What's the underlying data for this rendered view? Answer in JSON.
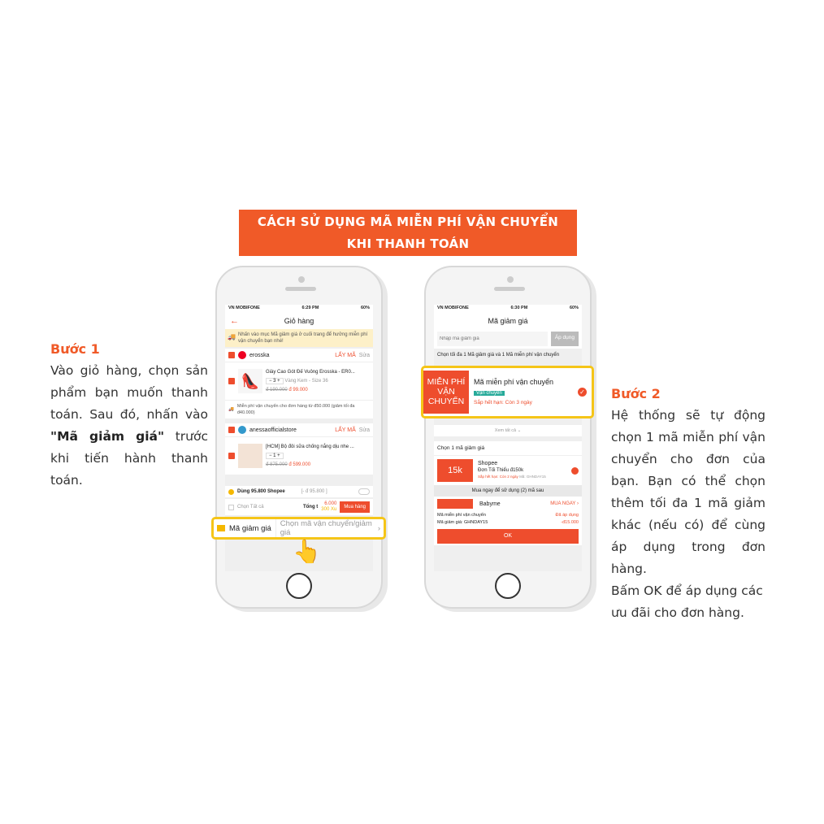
{
  "banner": {
    "line1": "CÁCH SỬ DỤNG MÃ MIỄN PHÍ VẬN CHUYỂN",
    "line2": "KHI THANH TOÁN"
  },
  "step1": {
    "title": "Bước 1",
    "text_a": "Vào giỏ hàng, chọn sản phẩm bạn muốn thanh toán. Sau đó, nhấn vào ",
    "bold": "\"Mã giảm giá\"",
    "text_b": " trước khi tiến hành thanh toán."
  },
  "step2": {
    "title": "Bước 2",
    "text": "Hệ thống sẽ tự động chọn 1 mã miễn phí vận chuyển cho đơn của bạn. Bạn có thể chọn thêm tối đa 1 mã giảm khác (nếu có) để cùng áp dụng trong đơn hàng.",
    "text2": "Bấm OK để áp dụng các ưu đãi cho đơn hàng."
  },
  "phone1": {
    "status": {
      "carrier": "VN MOBIFONE",
      "time": "6:29 PM",
      "battery": "60%"
    },
    "title": "Giỏ hàng",
    "notice": "Nhấn vào mục Mã giảm giá ở cuối trang để hưởng miễn phí vận chuyển bạn nhé!",
    "shops": [
      {
        "name": "erosska",
        "get_code": "LẤY MÃ",
        "edit": "Sửa",
        "product": "Giày Cao Gót Đế Vuông Erosska - ER0...",
        "qty": "3",
        "variant": "Vàng Kem - Size 36",
        "old_price": "đ 190.000",
        "price": "đ 99.000",
        "shipping": "Miễn phí vận chuyển cho đơn hàng từ đ50.000 (giảm tối đa đ40.000)"
      },
      {
        "name": "anessaofficialstore",
        "get_code": "LẤY MÃ",
        "edit": "Sửa",
        "product": "[HCM] Bộ đôi sữa chống nắng dịu nhe ...",
        "qty": "1",
        "old_price": "đ 875.000",
        "price": "đ 599.000"
      }
    ],
    "voucher_label": "Mã giảm giá",
    "voucher_placeholder": "Chọn mã vận chuyển/giảm giá",
    "coins": "Dùng 95.800 Shopee",
    "coins_value": "[- đ 95.800 ]",
    "select_all": "Chọn Tất cả",
    "total_label": "Tổng t",
    "total": "6.000",
    "xu": "300 Xu",
    "buy": "Mua hàng"
  },
  "phone2": {
    "status": {
      "carrier": "VN MOBIFONE",
      "time": "6:30 PM",
      "battery": "60%"
    },
    "title": "Mã giảm giá",
    "input_placeholder": "Nhập mã giảm giá",
    "apply": "Áp dụng",
    "hint": "Chọn tối đa 1 Mã giảm giá và 1 Mã miễn phí vận chuyển",
    "free_ship": {
      "badge": "MIỄN PHÍ VẬN CHUYỂN",
      "title": "Mã miễn phí vận chuyển",
      "tag": "Vận chuyển",
      "expiry": "Sắp hết hạn: Còn 3 ngày"
    },
    "see_all": "Xem tất cả",
    "choose_one": "Chọn 1 mã giảm giá",
    "voucher": {
      "badge": "15k",
      "shop": "Shopee",
      "min": "Đơn Tối Thiểu đ150k",
      "expiry": "Sắp hết hạn: Còn 2 ngày",
      "code": "Mã: GHNDAY15"
    },
    "buy_now_hint": "Mua ngay để sử dụng (2) mã sau",
    "babyme": "Babyme",
    "buy_now": "MUA NGAY",
    "summary": [
      {
        "label": "Mã miễn phí vận chuyển",
        "value": "Đã áp dụng"
      },
      {
        "label": "Mã giảm giá: GHNDAY15",
        "value": "-đ15.000"
      }
    ],
    "ok": "OK"
  },
  "colors": {
    "accent": "#f05a28",
    "highlight": "#f5c518",
    "shopee": "#ee4d2d"
  }
}
